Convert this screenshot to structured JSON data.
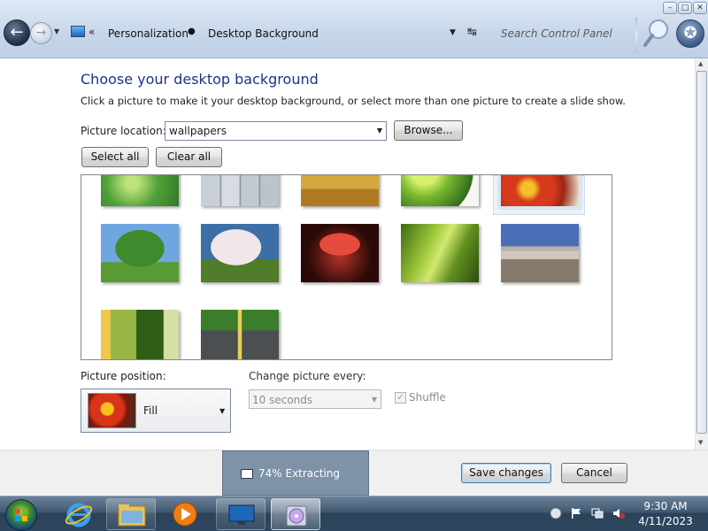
{
  "window": {
    "minimize": "–",
    "maximize": "□",
    "close": "✕"
  },
  "address_bar": {
    "chevron": "«",
    "breadcrumbs": [
      "Personalization",
      "Desktop Background"
    ],
    "separator": "►",
    "search_placeholder": "Search Control Panel"
  },
  "content": {
    "heading": "Choose your desktop background",
    "description": "Click a picture to make it your desktop background, or select more than one picture to create a slide show.",
    "picture_location_label": "Picture location:",
    "picture_location_value": "wallpapers",
    "browse_label": "Browse...",
    "select_all_label": "Select all",
    "clear_all_label": "Clear all",
    "pictures": [
      {
        "name": "green-droplets",
        "selected": false
      },
      {
        "name": "window-panes",
        "selected": false
      },
      {
        "name": "wheat-field",
        "selected": false
      },
      {
        "name": "green-vines",
        "selected": false
      },
      {
        "name": "red-flowers",
        "selected": true
      },
      {
        "name": "lone-tree",
        "selected": false
      },
      {
        "name": "blossom-tree",
        "selected": false
      },
      {
        "name": "red-sunset-tree",
        "selected": false
      },
      {
        "name": "green-grass",
        "selected": false
      },
      {
        "name": "highway-overpass",
        "selected": false
      },
      {
        "name": "dewdrop-stem",
        "selected": false
      },
      {
        "name": "forest-road",
        "selected": false
      }
    ],
    "picture_position_label": "Picture position:",
    "picture_position_value": "Fill",
    "change_picture_label": "Change picture every:",
    "change_picture_value": "10 seconds",
    "shuffle_label": "Shuffle",
    "shuffle_checked": true
  },
  "footer": {
    "progress_percent": 74,
    "progress_text": "74% Extracting",
    "save_label": "Save changes",
    "cancel_label": "Cancel"
  },
  "taskbar": {
    "apps": [
      "internet-explorer",
      "file-explorer",
      "media-player",
      "control-panel",
      "installer-disc"
    ],
    "clock_time": "9:30 AM",
    "clock_date": "4/11/2023"
  },
  "colors": {
    "heading": "#1e3287",
    "progress_bg": "#7e92a8",
    "taskbar": "#2b4259"
  }
}
